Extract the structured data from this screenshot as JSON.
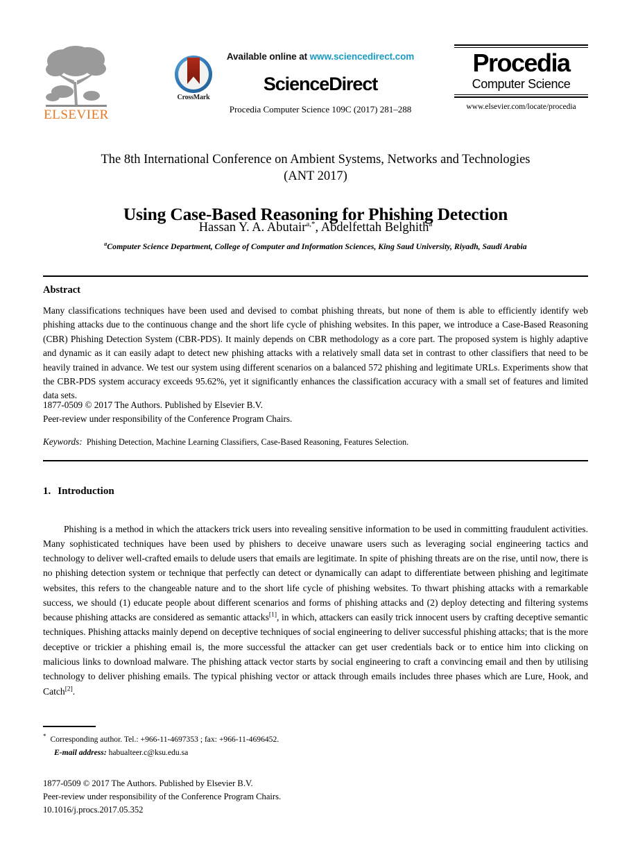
{
  "masthead": {
    "elsevier_logo_label": "ELSEVIER",
    "crossmark_label": "CrossMark",
    "available_prefix": "Available online at ",
    "available_url": "www.sciencedirect.com",
    "sciencedirect_wordmark": "ScienceDirect",
    "journal_citation": "Procedia Computer Science 109C (2017) 281–288",
    "procedia_title": "Procedia",
    "procedia_subtitle": "Computer Science",
    "procedia_url": "www.elsevier.com/locate/procedia",
    "colors": {
      "elsevier_orange": "#E87722",
      "sciencedirect_link": "#1a9bc4",
      "crossmark_ring": "#2f77b5",
      "crossmark_ribbon": "#8e1f10"
    }
  },
  "title_block": {
    "conference_line1": "The 8th International Conference on Ambient Systems, Networks and Technologies",
    "conference_line2": "(ANT 2017)",
    "paper_title": "Using Case-Based Reasoning for Phishing Detection",
    "author1_name": "Hassan Y. A. Abutair",
    "author1_marks": "a,*",
    "author_separator": ", ",
    "author2_name": "Abdelfettah Belghith",
    "author2_marks": "a",
    "affiliation_mark": "a",
    "affiliation": "Computer Science Department, College of Computer and Information Sciences, King Saud University, Riyadh, Saudi Arabia"
  },
  "abstract": {
    "heading": "Abstract",
    "body": "Many classifications techniques have been used and devised to combat phishing threats, but none of them is able to efficiently identify web phishing attacks due to the continuous change and the short life cycle of phishing websites. In this paper, we introduce a Case-Based Reasoning (CBR) Phishing Detection System (CBR-PDS). It mainly depends on CBR methodology as a core part. The proposed system is highly adaptive and dynamic as it can easily adapt to detect new phishing attacks with a relatively small data set in contrast to other classifiers that need to be heavily trained in advance. We test our system using different scenarios on a balanced 572 phishing and legitimate URLs. Experiments show that the CBR-PDS system accuracy exceeds 95.62%, yet it significantly enhances the classification accuracy with a small set of features and limited data sets.",
    "copyright_line1": "1877-0509 © 2017 The Authors. Published by Elsevier B.V.",
    "copyright_line2": "Peer-review under responsibility of the Conference Program Chairs.",
    "keywords_label": "Keywords:",
    "keywords_value": "Phishing Detection, Machine Learning Classifiers, Case-Based Reasoning, Features Selection."
  },
  "introduction": {
    "number": "1.",
    "heading": "Introduction",
    "para_part1": "Phishing is a method in which the attackers trick users into revealing sensitive information to be used in committing fraudulent activities. Many sophisticated techniques have been used by phishers to deceive unaware users such as leveraging social engineering tactics and technology to deliver well-crafted emails to delude users that emails are legitimate. In spite of phishing threats are on the rise, until now, there is no phishing detection system or technique that perfectly can detect or dynamically can adapt to differentiate between phishing and legitimate websites, this refers to the changeable nature and to the short life cycle of phishing websites. To thwart phishing attacks with a remarkable success, we should (1) educate people about different scenarios and forms of phishing attacks and (2) deploy detecting and filtering systems because phishing attacks are considered as semantic attacks",
    "ref1": "[1]",
    "para_part2": ", in which, attackers can easily trick innocent users by crafting deceptive semantic techniques. Phishing attacks mainly depend on deceptive techniques of social engineering to deliver successful phishing attacks; that is the more deceptive or trickier a phishing email is, the more successful the attacker can get user credentials back or to entice him into clicking on malicious links to download malware. The phishing attack vector starts by social engineering to craft a convincing email and then by utilising technology to deliver phishing emails. The typical phishing vector or attack through emails includes three phases which are Lure, Hook, and Catch",
    "ref2": "[2]",
    "para_part3": "."
  },
  "footnote": {
    "marker": "*",
    "corresponding": "Corresponding author. Tel.: +966-11-4697353 ; fax: +966-11-4696452.",
    "email_label": "E-mail address:",
    "email_value": "habualteer.c@ksu.edu.sa"
  },
  "imprint": {
    "line1": "1877-0509 © 2017 The Authors. Published by Elsevier B.V.",
    "line2": "Peer-review under responsibility of the Conference Program Chairs.",
    "line3": "10.1016/j.procs.2017.05.352"
  }
}
